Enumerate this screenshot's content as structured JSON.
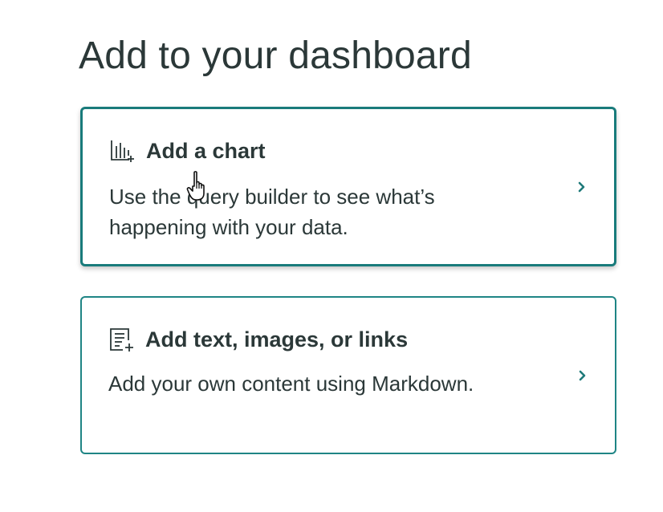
{
  "page": {
    "title": "Add to your dashboard"
  },
  "cards": [
    {
      "title": "Add a chart",
      "description": "Use the query builder to see what’s happening with your data.",
      "icon": "chart-add-icon"
    },
    {
      "title": "Add text, images, or links",
      "description": "Add your own content using Markdown.",
      "icon": "text-add-icon"
    }
  ],
  "colors": {
    "accent": "#1f8585",
    "text": "#2b3838"
  }
}
